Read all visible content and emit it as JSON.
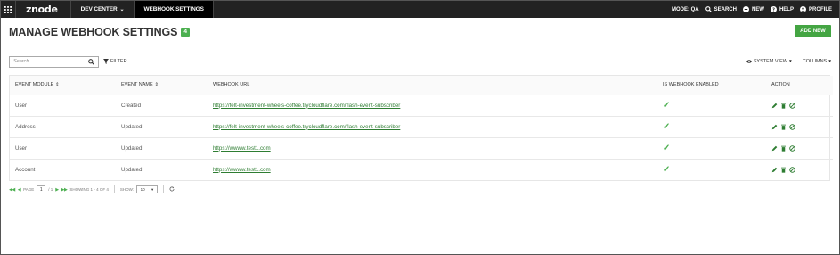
{
  "topbar": {
    "logo": "znode",
    "nav": [
      {
        "label": "DEV CENTER",
        "has_chevron": true
      },
      {
        "label": "WEBHOOK SETTINGS",
        "active": true
      }
    ],
    "mode": "MODE: QA",
    "search": "SEARCH",
    "new": "NEW",
    "help": "HELP",
    "profile": "PROFILE"
  },
  "header": {
    "title": "MANAGE WEBHOOK SETTINGS",
    "count": "4",
    "add_new": "ADD NEW"
  },
  "toolbar": {
    "search_placeholder": "Search...",
    "filter": "FILTER",
    "system_view": "SYSTEM VIEW",
    "columns": "COLUMNS"
  },
  "table": {
    "columns": [
      "EVENT MODULE",
      "EVENT NAME",
      "WEBHOOK URL",
      "IS WEBHOOK ENABLED",
      "ACTION"
    ],
    "rows": [
      {
        "module": "User",
        "event": "Created",
        "url": "https://felt-investment-wheels-coffee.trycloudflare.com/flash-event-subscriber",
        "enabled": true
      },
      {
        "module": "Address",
        "event": "Updated",
        "url": "https://felt-investment-wheels-coffee.trycloudflare.com/flash-event-subscriber",
        "enabled": true
      },
      {
        "module": "User",
        "event": "Updated",
        "url": "https://wwww.test1.com",
        "enabled": true
      },
      {
        "module": "Account",
        "event": "Updated",
        "url": "https://wwww.test1.com",
        "enabled": true
      }
    ]
  },
  "pager": {
    "page_label": "PAGE",
    "page": "1",
    "of": "/ 1",
    "showing": "SHOWING 1 - 4 OF 4",
    "show_label": "SHOW:",
    "page_size": "10"
  },
  "colors": {
    "topbar": "#222222",
    "accent_green": "#44a543",
    "link_green": "#2e7d32"
  }
}
